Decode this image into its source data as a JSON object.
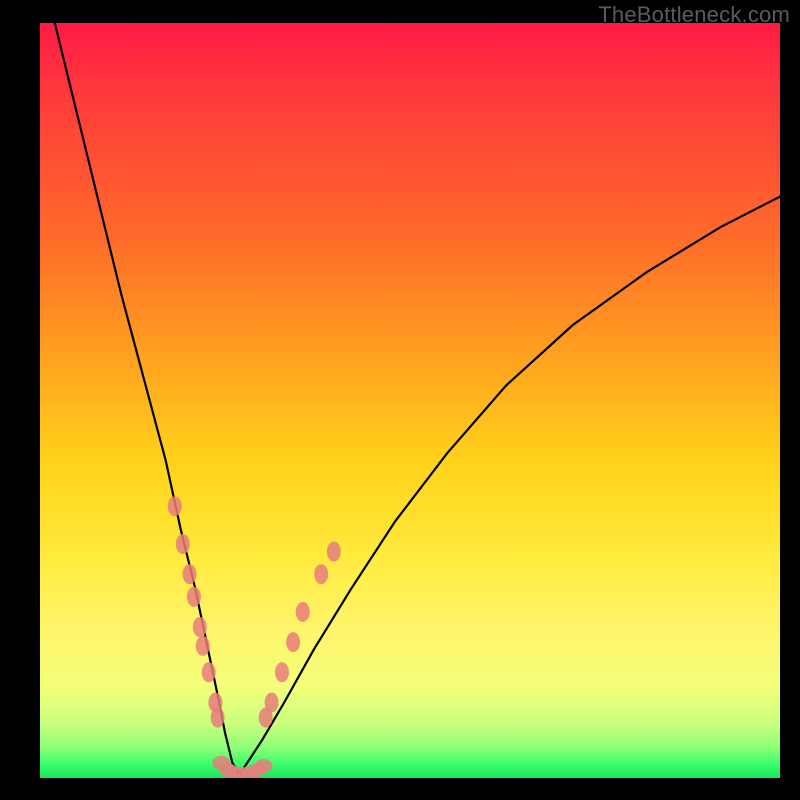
{
  "watermark": "TheBottleneck.com",
  "colors": {
    "frame": "#000000",
    "dot": "#e77c7c",
    "curve": "#000000",
    "gradient_stops": [
      "#ff1a45",
      "#ff3b3b",
      "#ff6a2a",
      "#ffa41f",
      "#ffd21a",
      "#ffe93a",
      "#fff56a",
      "#f4ff7a",
      "#c6ff7d",
      "#8dff77",
      "#3fff6e",
      "#18e85a"
    ]
  },
  "chart_data": {
    "type": "line",
    "title": "",
    "xlabel": "",
    "ylabel": "",
    "xlim": [
      0,
      100
    ],
    "ylim": [
      0,
      100
    ],
    "series": [
      {
        "name": "bottleneck-curve",
        "x": [
          2,
          5,
          8,
          11,
          14,
          17,
          19,
          21,
          22.5,
          24,
          25,
          26,
          27,
          28,
          30,
          33,
          37,
          42,
          48,
          55,
          63,
          72,
          82,
          92,
          100
        ],
        "y": [
          100,
          88,
          76,
          64,
          53,
          42,
          33,
          25,
          18,
          11,
          6,
          2,
          0.5,
          2,
          5,
          10,
          17,
          25,
          34,
          43,
          52,
          60,
          67,
          73,
          77
        ]
      }
    ],
    "scatter_left": {
      "name": "dots-left-branch",
      "points": [
        {
          "x": 18.2,
          "y": 36
        },
        {
          "x": 19.3,
          "y": 31
        },
        {
          "x": 20.2,
          "y": 27
        },
        {
          "x": 20.8,
          "y": 24
        },
        {
          "x": 21.6,
          "y": 20
        },
        {
          "x": 22.0,
          "y": 17.5
        },
        {
          "x": 22.8,
          "y": 14
        },
        {
          "x": 23.7,
          "y": 10
        },
        {
          "x": 24.0,
          "y": 8
        }
      ]
    },
    "scatter_right": {
      "name": "dots-right-branch",
      "points": [
        {
          "x": 30.5,
          "y": 8
        },
        {
          "x": 31.3,
          "y": 10
        },
        {
          "x": 32.7,
          "y": 14
        },
        {
          "x": 34.2,
          "y": 18
        },
        {
          "x": 35.5,
          "y": 22
        },
        {
          "x": 38.0,
          "y": 27
        },
        {
          "x": 39.7,
          "y": 30
        }
      ]
    },
    "scatter_bottom": {
      "name": "dots-valley",
      "points": [
        {
          "x": 24.5,
          "y": 2
        },
        {
          "x": 25.5,
          "y": 1
        },
        {
          "x": 26.7,
          "y": 0.6
        },
        {
          "x": 28.0,
          "y": 0.6
        },
        {
          "x": 29.2,
          "y": 1.0
        },
        {
          "x": 30.2,
          "y": 1.6
        }
      ]
    }
  }
}
